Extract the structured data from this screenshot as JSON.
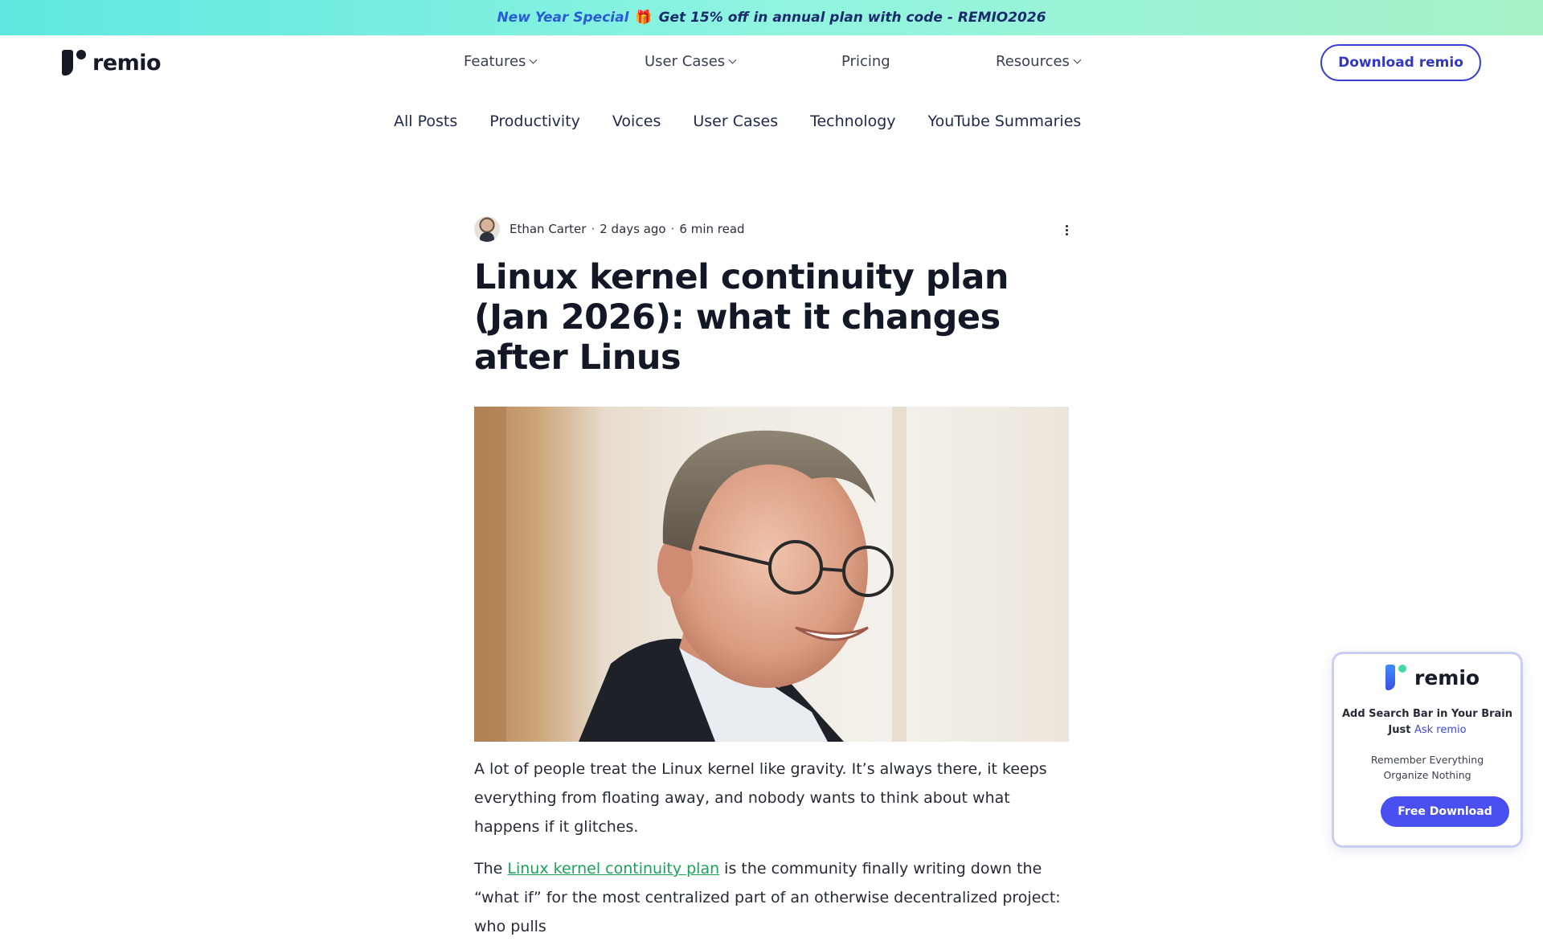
{
  "promo": {
    "highlight": "New Year Special",
    "gift_icon": "🎁",
    "message": "Get 15% off in annual plan with code - REMIO2026"
  },
  "header": {
    "logo_text": "remio",
    "nav": [
      {
        "label": "Features",
        "has_dropdown": true
      },
      {
        "label": "User Cases",
        "has_dropdown": true
      },
      {
        "label": "Pricing",
        "has_dropdown": false
      },
      {
        "label": "Resources",
        "has_dropdown": true
      }
    ],
    "download_label": "Download remio"
  },
  "categories": [
    "All Posts",
    "Productivity",
    "Voices",
    "User Cases",
    "Technology",
    "YouTube Summaries"
  ],
  "article": {
    "author": "Ethan Carter",
    "posted": "2 days ago",
    "read_time": "6 min read",
    "title": "Linux kernel continuity plan (Jan 2026): what it changes after Linus",
    "para1": "A lot of people treat the Linux kernel like gravity. It’s always there, it keeps everything from floating away, and nobody wants to think about what happens if it glitches.",
    "para2_before": "The ",
    "para2_link": "Linux kernel continuity plan",
    "para2_after": " is the community finally writing down the “what if” for the most centralized part of an otherwise decentralized project: who pulls"
  },
  "widget": {
    "logo_text": "remio",
    "headline": "Add Search Bar in Your Brain",
    "just": "Just",
    "ask": "Ask remio",
    "line1": "Remember Everything",
    "line2": "Organize Nothing",
    "button": "Free Download"
  },
  "colors": {
    "accent": "#3b3fd1",
    "link": "#1ca35a",
    "promo_gradient_start": "#5ee7e0",
    "promo_gradient_end": "#a8f2c8"
  }
}
